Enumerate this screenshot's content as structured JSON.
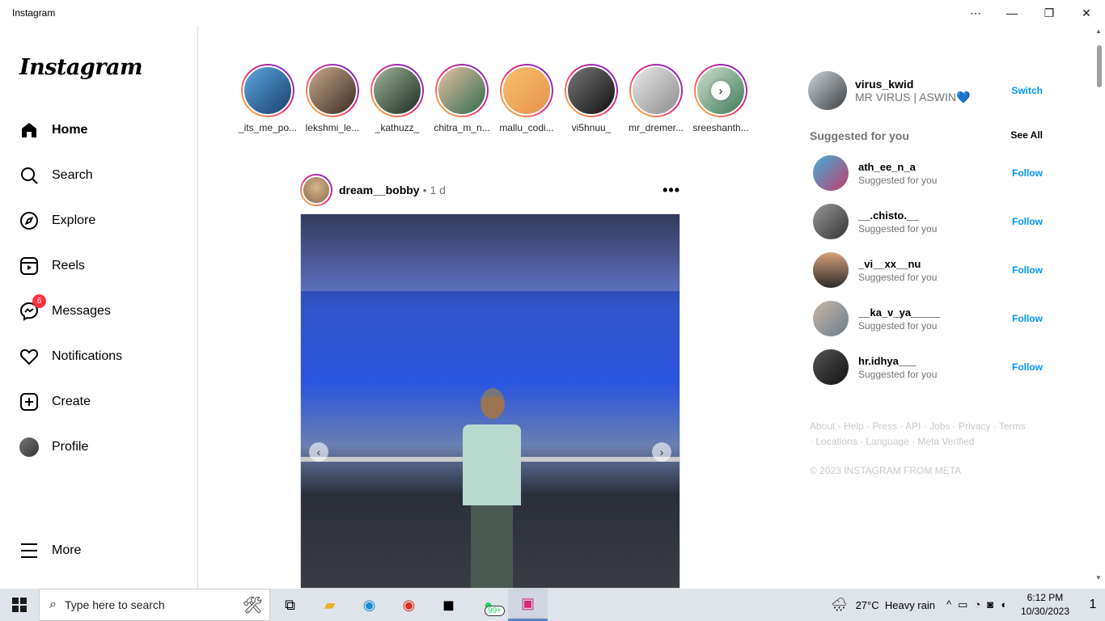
{
  "window": {
    "title": "Instagram",
    "controls": {
      "more": "⋯",
      "minimize": "—",
      "maximize": "❐",
      "close": "✕"
    }
  },
  "sidebar": {
    "logo": "Instagram",
    "items": [
      {
        "label": "Home",
        "icon": "home-icon"
      },
      {
        "label": "Search",
        "icon": "search-icon"
      },
      {
        "label": "Explore",
        "icon": "compass-icon"
      },
      {
        "label": "Reels",
        "icon": "reels-icon"
      },
      {
        "label": "Messages",
        "icon": "messenger-icon",
        "badge": "6"
      },
      {
        "label": "Notifications",
        "icon": "heart-icon"
      },
      {
        "label": "Create",
        "icon": "plus-square-icon"
      },
      {
        "label": "Profile",
        "icon": "avatar"
      }
    ],
    "more": "More"
  },
  "stories": [
    {
      "name": "_its_me_po..."
    },
    {
      "name": "lekshmi_le..."
    },
    {
      "name": "_kathuzz_"
    },
    {
      "name": "chitra_m_n..."
    },
    {
      "name": "mallu_codi..."
    },
    {
      "name": "vi5hnuu_"
    },
    {
      "name": "mr_dremer..."
    },
    {
      "name": "sreeshanth..."
    }
  ],
  "post": {
    "username": "dream__bobby",
    "separator": "•",
    "time": "1 d",
    "more": "•••"
  },
  "account": {
    "username": "virus_kwid",
    "name": "MR VIRUS | ASWIN💙",
    "switch": "Switch"
  },
  "suggestions": {
    "title": "Suggested for you",
    "see_all": "See All",
    "items": [
      {
        "username": "ath_ee_n_a",
        "sub": "Suggested for you",
        "action": "Follow"
      },
      {
        "username": "__.chisto.__",
        "sub": "Suggested for you",
        "action": "Follow"
      },
      {
        "username": "_vi__xx__nu",
        "sub": "Suggested for you",
        "action": "Follow"
      },
      {
        "username": "__ka_v_ya_____",
        "sub": "Suggested for you",
        "action": "Follow"
      },
      {
        "username": "hr.idhya___",
        "sub": "Suggested for you",
        "action": "Follow"
      }
    ]
  },
  "footer": {
    "links": "About · Help · Press · API · Jobs · Privacy · Terms · Locations · Language · Meta Verified",
    "copyright": "© 2023 INSTAGRAM FROM META"
  },
  "taskbar": {
    "search_placeholder": "Type here to search",
    "whatsapp_badge": "99+",
    "weather": {
      "temp": "27°C",
      "condition": "Heavy rain"
    },
    "clock": {
      "time": "6:12 PM",
      "date": "10/30/2023"
    },
    "notifications_count": "1"
  },
  "colors": {
    "accent": "#0095f6",
    "badge": "#ff3040",
    "border": "#dbdbdb"
  }
}
